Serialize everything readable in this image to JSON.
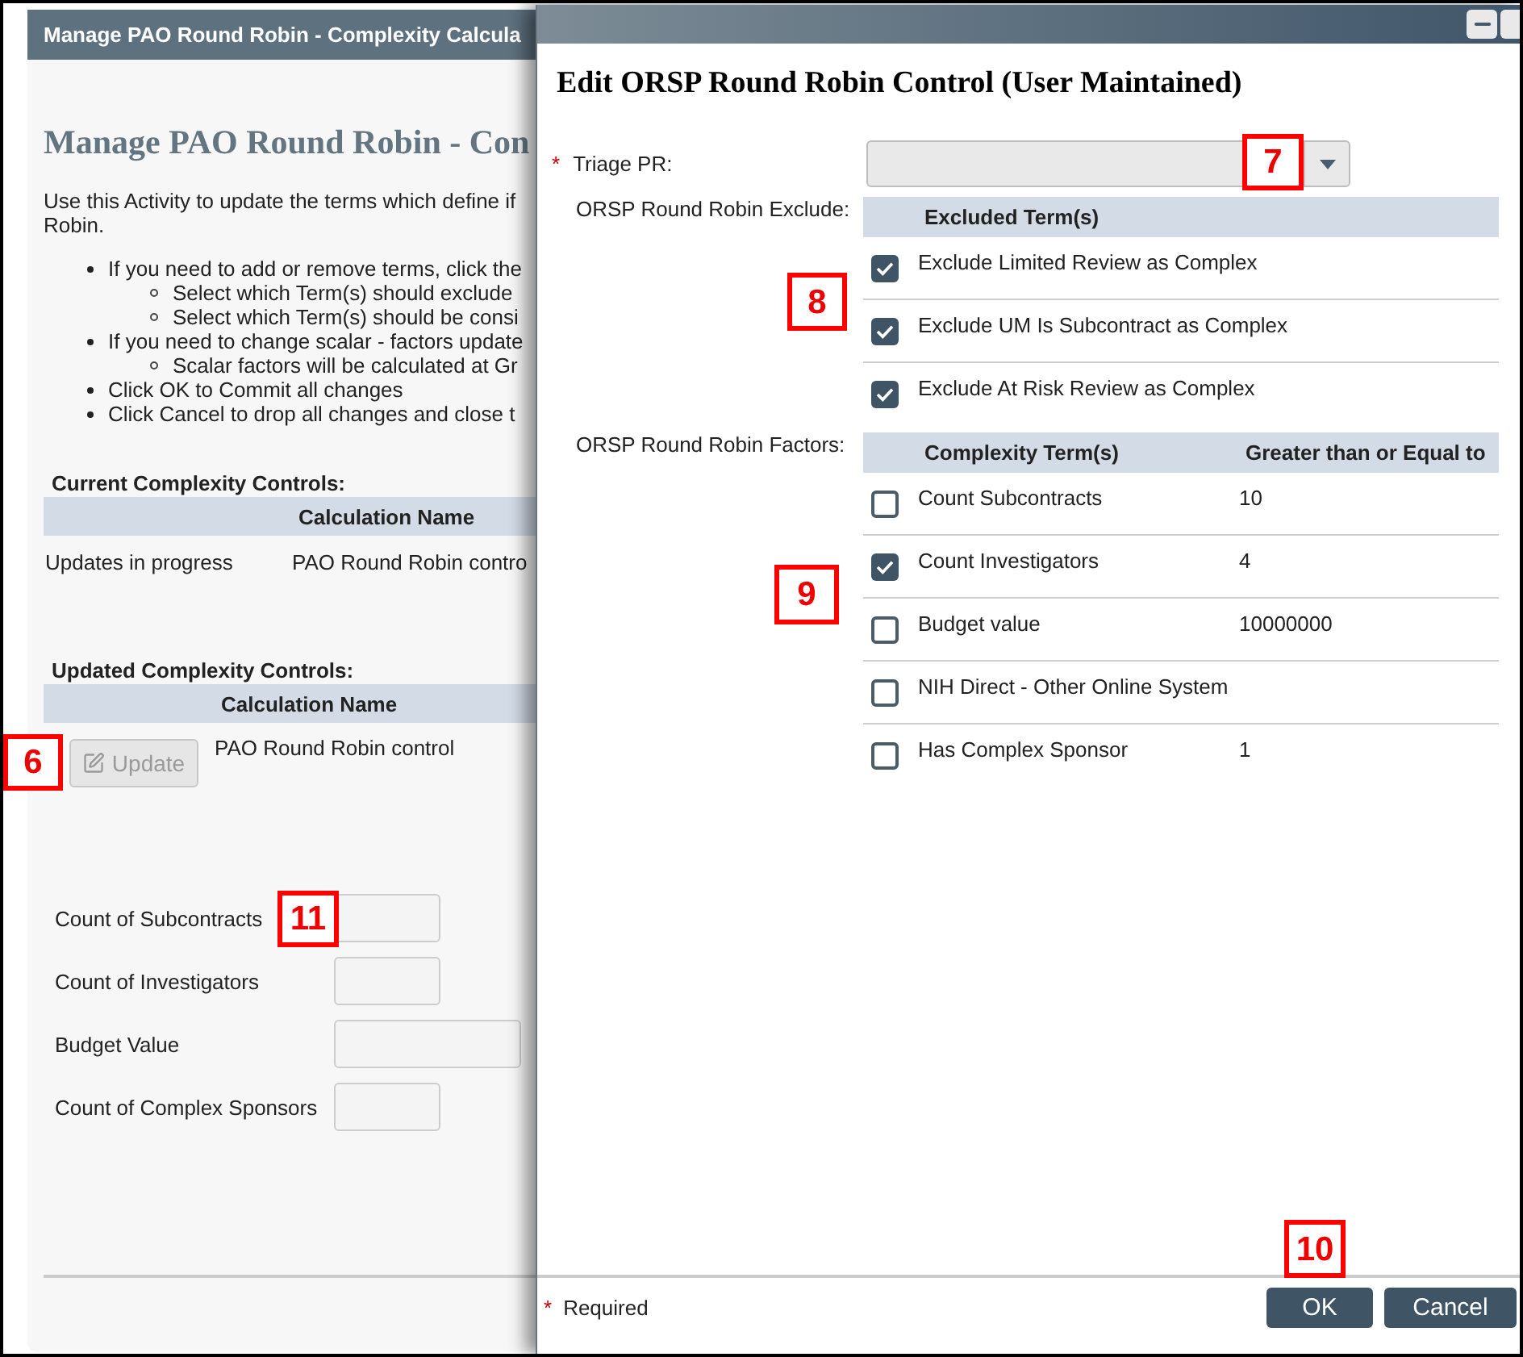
{
  "page": {
    "title": "Manage PAO Round Robin - Complexity Calcula",
    "heading": "Manage PAO Round Robin - Con",
    "intro_lines": [
      "Use this Activity to update the terms which define if",
      "Robin."
    ],
    "instructions": [
      {
        "text": "If you need to add or remove terms, click the",
        "children": [
          {
            "text": "Select which Term(s) should exclude"
          },
          {
            "text": "Select which Term(s) should be consi"
          }
        ]
      },
      {
        "text": "If you need to change scalar - factors update",
        "children": [
          {
            "text": "Scalar factors will be calculated at Gr"
          }
        ]
      },
      {
        "text": "Click OK to Commit all changes"
      },
      {
        "text": "Click Cancel to drop all changes and close t"
      }
    ],
    "current_controls": {
      "title": "Current Complexity Controls:",
      "header": "Calculation Name",
      "rows": [
        {
          "status": "Updates in progress",
          "name": "PAO Round Robin contro"
        }
      ]
    },
    "updated_controls": {
      "title": "Updated Complexity Controls:",
      "header": "Calculation Name",
      "rows": [
        {
          "button": {
            "label": "Update",
            "disabled": true
          },
          "name": "PAO Round Robin control",
          "callout": "6"
        }
      ]
    },
    "fields": [
      {
        "label": "Count of Subcontracts",
        "kind": "count",
        "callout": "11"
      },
      {
        "label": "Count of Investigators",
        "kind": "count"
      },
      {
        "label": "Budget Value",
        "kind": "amount"
      },
      {
        "label": "Count of Complex Sponsors",
        "kind": "count"
      }
    ]
  },
  "dialog": {
    "title": "Edit ORSP Round Robin Control (User Maintained)",
    "triage": {
      "required_mark": "*",
      "label": "Triage PR:",
      "callout": "7"
    },
    "exclude": {
      "label": "ORSP Round Robin Exclude:",
      "columns": [
        "Excluded Term(s)"
      ],
      "callout": "8",
      "rows": [
        {
          "term": "Exclude Limited Review as Complex",
          "checked": true
        },
        {
          "term": "Exclude UM Is Subcontract as Complex",
          "checked": true
        },
        {
          "term": "Exclude At Risk Review as Complex",
          "checked": true
        }
      ]
    },
    "factors": {
      "label": "ORSP Round Robin Factors:",
      "columns": [
        "Complexity Term(s)",
        "Greater than or Equal to"
      ],
      "callout": "9",
      "rows": [
        {
          "term": "Count Subcontracts",
          "value": "10",
          "checked": false
        },
        {
          "term": "Count Investigators",
          "value": "4",
          "checked": true
        },
        {
          "term": "Budget value",
          "value": "10000000",
          "checked": false
        },
        {
          "term": "NIH Direct - Other Online System",
          "checked": false
        },
        {
          "term": "Has Complex Sponsor",
          "value": "1",
          "checked": false
        }
      ]
    },
    "footer": {
      "required_mark": "*",
      "note": "Required",
      "buttons": [
        {
          "label": "OK",
          "callout": "10"
        },
        {
          "label": "Cancel"
        }
      ]
    }
  }
}
